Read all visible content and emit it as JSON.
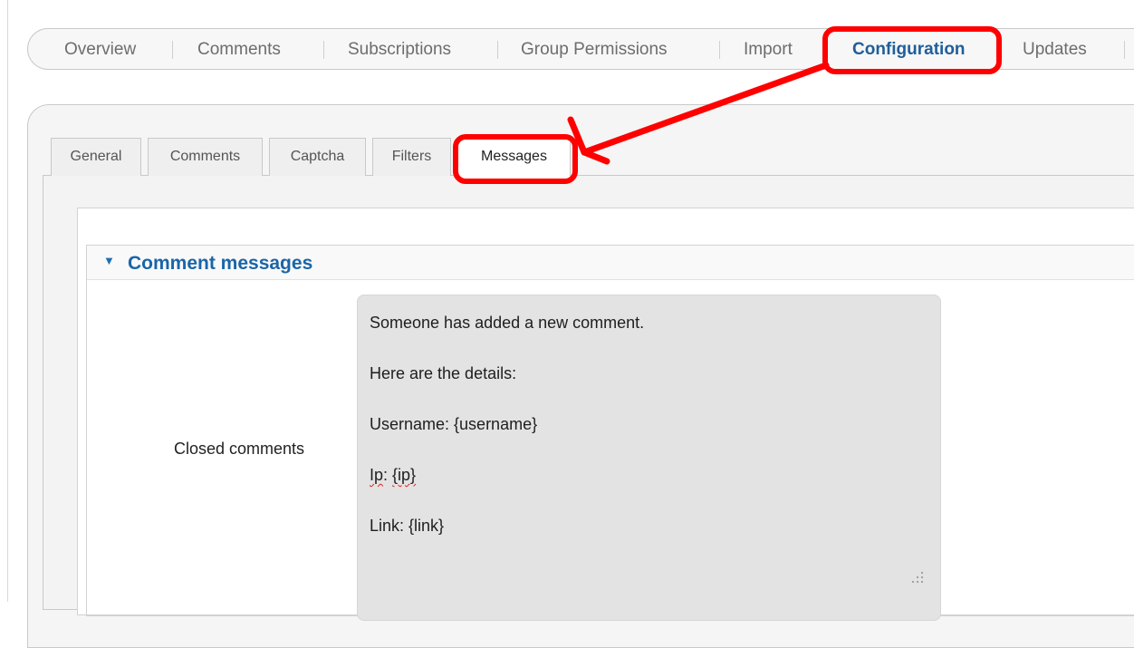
{
  "top_nav": {
    "tabs": [
      "Overview",
      "Comments",
      "Subscriptions",
      "Group Permissions",
      "Import",
      "Configuration",
      "Updates"
    ],
    "active": "Configuration"
  },
  "sub_tabs": {
    "tabs": [
      "General",
      "Comments",
      "Captcha",
      "Filters",
      "Messages"
    ],
    "active": "Messages"
  },
  "section": {
    "title": "Comment messages",
    "collapse_icon": "triangle-down-icon"
  },
  "field": {
    "label": "Closed comments",
    "value_lines": [
      "Someone has added a new comment.",
      "Here are the details:",
      "Username: {username}"
    ],
    "ip_label": "Ip",
    "ip_sep": ": ",
    "ip_value": "{ip}",
    "link_line": "Link: {link}",
    "resize_icon": "resize-grip-icon"
  },
  "annotation": {
    "color": "#ff0000",
    "highlight_1": "Configuration",
    "highlight_2": "Messages",
    "arrow_icon": "red-arrow-icon"
  }
}
